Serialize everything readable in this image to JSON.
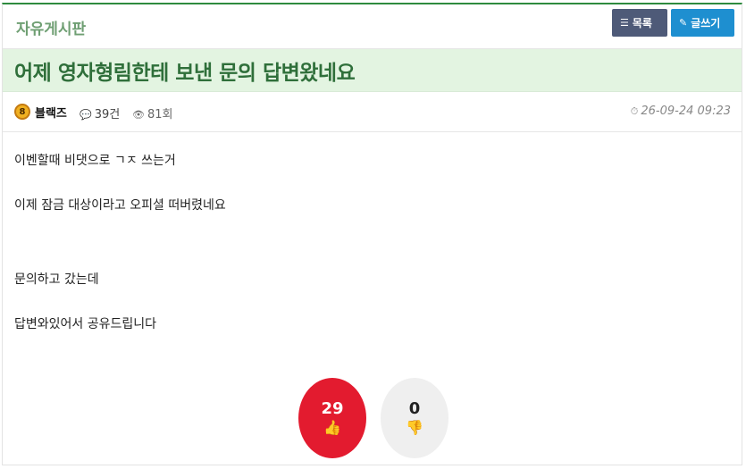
{
  "board": {
    "name": "자유게시판",
    "list_label": "목록",
    "write_label": "글쓰기"
  },
  "post": {
    "title": "어제 영자형림한테 보낸 문의 답변왔네요",
    "author": "블랙즈",
    "level": "8",
    "comments": "39건",
    "views": "81회",
    "date": "26-09-24 09:23",
    "body": [
      "이벤할때 비댓으로 ㄱㅈ 쓰는거",
      "이제 잠금 대상이라고 오피셜 떠버렸네요",
      "문의하고 갔는데",
      "답변와있어서 공유드립니다"
    ]
  },
  "votes": {
    "up": "29",
    "down": "0"
  },
  "colors": {
    "accent_green": "#2e8b3e",
    "title_bg": "#e3f4e1",
    "vote_up": "#e31b2f",
    "btn_list": "#4e5a78",
    "btn_write": "#1e8fd0"
  }
}
